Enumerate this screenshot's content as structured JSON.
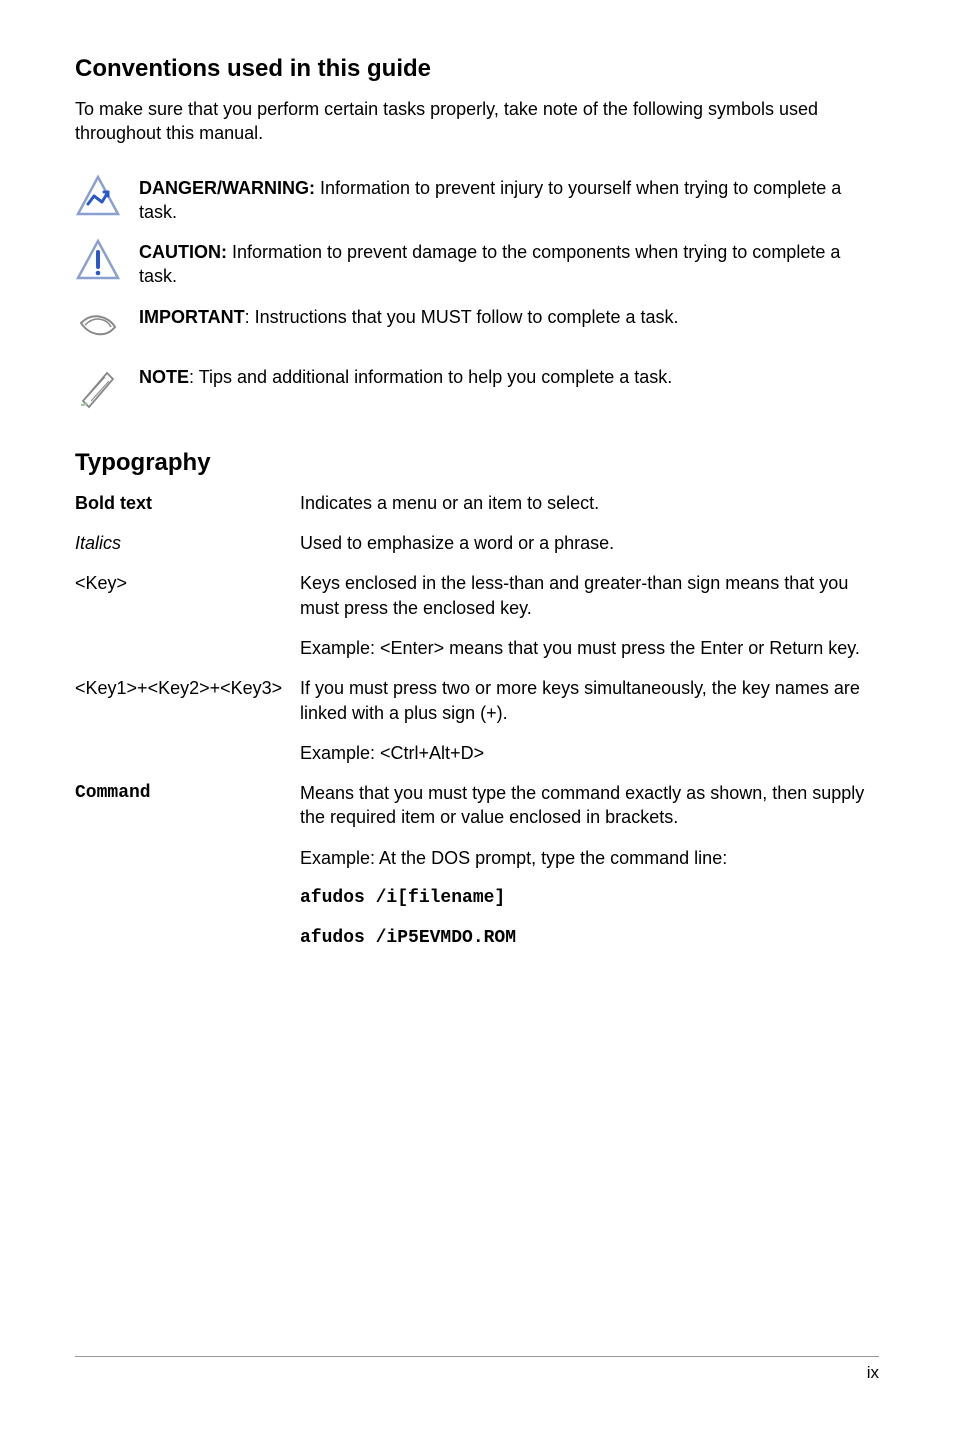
{
  "heading_conventions": "Conventions used in this guide",
  "intro": "To make sure that you perform certain tasks properly, take note of the following symbols used throughout this manual.",
  "callouts": {
    "danger": {
      "label": "DANGER/WARNING:",
      "text": " Information to prevent injury to yourself when trying to complete a task."
    },
    "caution": {
      "label": "CAUTION:",
      "text": " Information to prevent damage to the components when trying to complete a task."
    },
    "important": {
      "label": "IMPORTANT",
      "text": ": Instructions that you MUST follow to complete a task."
    },
    "note": {
      "label": "NOTE",
      "text": ": Tips and additional information to help you complete a task."
    }
  },
  "heading_typography": "Typography",
  "typography": {
    "bold": {
      "term": "Bold text",
      "desc": "Indicates a menu or an item to select."
    },
    "italics": {
      "term": "Italics",
      "desc": "Used to emphasize a word or a phrase."
    },
    "key": {
      "term": "<Key>",
      "desc1": "Keys enclosed in the less-than and greater-than sign means that you must press the enclosed key.",
      "desc2": "Example: <Enter> means that you must press the Enter or Return key."
    },
    "keycombo": {
      "term": "<Key1>+<Key2>+<Key3>",
      "desc1": "If you must press two or more keys simultaneously, the key names are linked with a plus sign (+).",
      "desc2": "Example: <Ctrl+Alt+D>"
    },
    "command": {
      "term": "Command",
      "desc1": "Means that you must type the command exactly as shown, then supply the required item or value enclosed in brackets.",
      "desc2": "Example: At the DOS prompt, type the command line:",
      "code1": "afudos /i[filename]",
      "code2": "afudos /iP5EVMDO.ROM"
    }
  },
  "page_number": "ix"
}
